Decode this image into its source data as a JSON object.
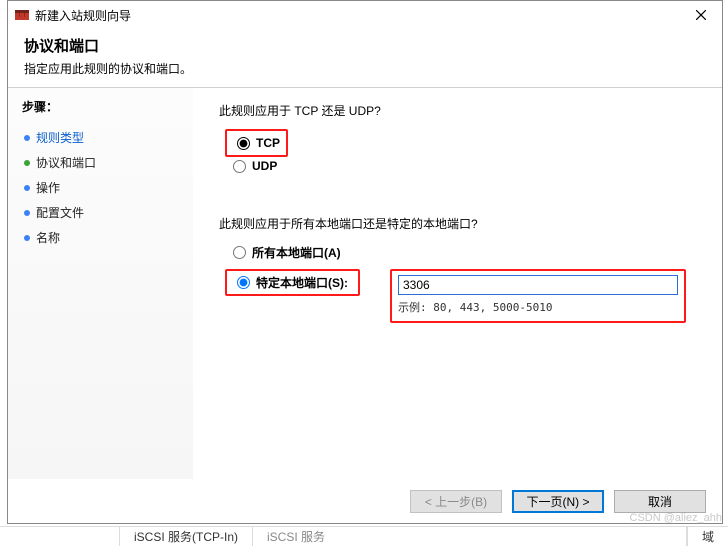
{
  "title": "新建入站规则向导",
  "header": {
    "title": "协议和端口",
    "subtitle": "指定应用此规则的协议和端口。"
  },
  "sidebar": {
    "label": "步骤：",
    "items": [
      {
        "label": "规则类型"
      },
      {
        "label": "协议和端口"
      },
      {
        "label": "操作"
      },
      {
        "label": "配置文件"
      },
      {
        "label": "名称"
      }
    ]
  },
  "main": {
    "q1": "此规则应用于 TCP 还是 UDP?",
    "tcp": "TCP",
    "udp": "UDP",
    "q2": "此规则应用于所有本地端口还是特定的本地端口?",
    "all_ports": "所有本地端口(A)",
    "specific_ports": "特定本地端口(S):",
    "ports_value": "3306",
    "ports_example": "示例: 80, 443, 5000-5010"
  },
  "footer": {
    "back": "< 上一步(B)",
    "next": "下一页(N) >",
    "cancel": "取消"
  },
  "below": {
    "cell1": "iSCSI 服务(TCP-In)",
    "cell2": "iSCSI 服务",
    "cell3": "域"
  },
  "watermark": "CSDN @aliez_ahh"
}
